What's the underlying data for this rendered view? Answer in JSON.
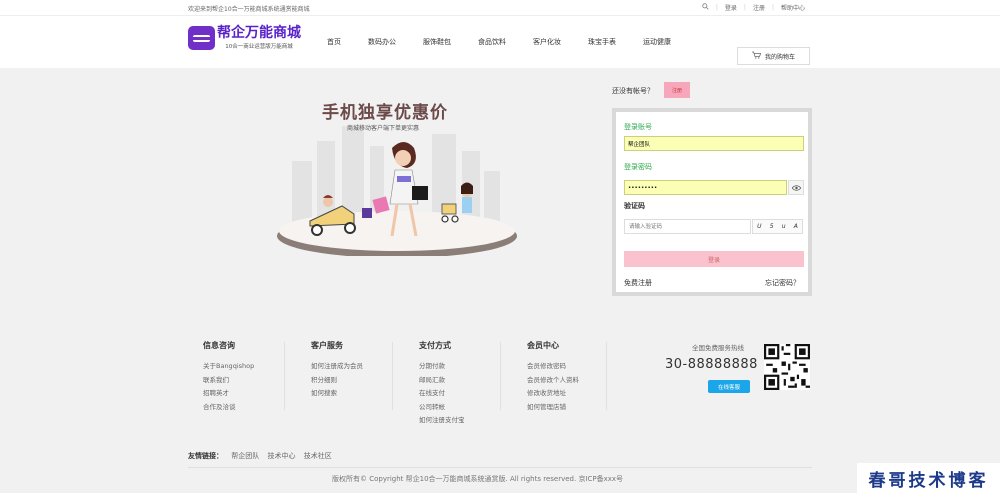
{
  "topbar": {
    "welcome": "欢迎来到帮企10合一万能商城系统通赏能商城",
    "login": "登录",
    "register": "注册",
    "help": "帮助中心"
  },
  "logo": {
    "name": "帮企万能商城",
    "tagline": "10合一商业运营版万能商城"
  },
  "nav": [
    "首页",
    "数码办公",
    "服饰鞋包",
    "食品饮料",
    "客户化妆",
    "珠宝手表",
    "运动健康"
  ],
  "cart": {
    "label": "我的购物车"
  },
  "promo": {
    "title": "手机独享优惠价",
    "subtitle": "商城移动客户端下单更实惠"
  },
  "login_panel": {
    "no_account_hint": "还没有帐号？",
    "register_button": "注册",
    "account_label": "登录账号",
    "account_value": "帮企团队",
    "password_label": "登录密码",
    "password_value": "•••••••••",
    "captcha_label": "验证码",
    "captcha_placeholder": "请输入验证码",
    "captcha_chars": [
      "U",
      "5",
      "u",
      "A"
    ],
    "login_button": "登录",
    "free_register": "免费注册",
    "forgot_password": "忘记密码？"
  },
  "footer": {
    "columns": [
      {
        "title": "信息咨询",
        "links": [
          "关于Bangqishop",
          "联系我们",
          "招聘英才",
          "合作及洽谈"
        ]
      },
      {
        "title": "客户服务",
        "links": [
          "如何注册成为会员",
          "积分细则",
          "如何搜索"
        ]
      },
      {
        "title": "支付方式",
        "links": [
          "分期付款",
          "邮局汇款",
          "在线支付",
          "公司转帐",
          "如何注册支付宝"
        ]
      },
      {
        "title": "会员中心",
        "links": [
          "会员修改密码",
          "会员修改个人资料",
          "修改收货地址",
          "如何管理店铺"
        ]
      }
    ],
    "hotline_label": "全国免费服务热线",
    "hotline": "30-88888888",
    "online_service": "在线客服",
    "friend_links_label": "友情链接：",
    "friend_links": [
      "帮企团队",
      "技术中心",
      "技术社区"
    ],
    "copyright": "版权所有© Copyright 帮企10合一万能商城系统通赏版. All rights reserved. 京ICP备xxx号"
  },
  "watermark": "春哥技术博客",
  "colors": {
    "brand": "#5a22c9",
    "accent_green": "#2aa94a",
    "pink": "#f9c2cd",
    "blue_button": "#1aa6e8"
  }
}
